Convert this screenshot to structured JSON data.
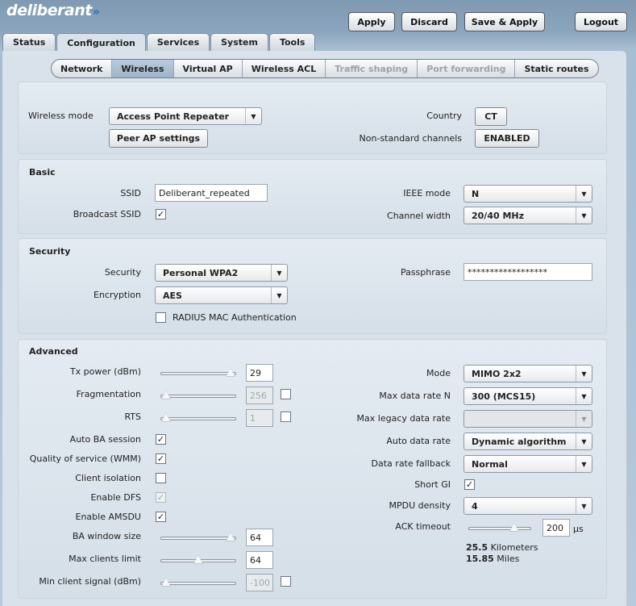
{
  "brand": {
    "name": "deliberant",
    "chevrons": "»"
  },
  "top_buttons": {
    "apply": "Apply",
    "discard": "Discard",
    "save_apply": "Save & Apply",
    "logout": "Logout"
  },
  "tabs": [
    "Status",
    "Configuration",
    "Services",
    "System",
    "Tools"
  ],
  "subtabs": [
    "Network",
    "Wireless",
    "Virtual AP",
    "Wireless ACL",
    "Traffic shaping",
    "Port forwarding",
    "Static routes"
  ],
  "general": {
    "wireless_mode_label": "Wireless mode",
    "wireless_mode_value": "Access Point Repeater",
    "peer_ap_button": "Peer AP settings",
    "country_label": "Country",
    "country_value": "CT",
    "nonstd_label": "Non-standard channels",
    "nonstd_value": "ENABLED"
  },
  "basic": {
    "title": "Basic",
    "ssid_label": "SSID",
    "ssid_value": "Deliberant_repeated",
    "broadcast_label": "Broadcast SSID",
    "broadcast_checked": true,
    "ieee_label": "IEEE mode",
    "ieee_value": "N",
    "channel_width_label": "Channel width",
    "channel_width_value": "20/40 MHz"
  },
  "security": {
    "title": "Security",
    "security_label": "Security",
    "security_value": "Personal WPA2",
    "encryption_label": "Encryption",
    "encryption_value": "AES",
    "radius_label": "RADIUS MAC Authentication",
    "radius_checked": false,
    "passphrase_label": "Passphrase",
    "passphrase_value": "******************"
  },
  "advanced": {
    "title": "Advanced",
    "tx_power_label": "Tx power (dBm)",
    "tx_power_value": "29",
    "tx_power_level": 1.0,
    "fragmentation_label": "Fragmentation",
    "fragmentation_value": "256",
    "rts_label": "RTS",
    "rts_value": "1",
    "auto_ba_label": "Auto BA session",
    "qos_label": "Quality of service (WMM)",
    "client_isolation_label": "Client isolation",
    "dfs_label": "Enable DFS",
    "amsdu_label": "Enable AMSDU",
    "ba_window_label": "BA window size",
    "ba_window_value": "64",
    "ba_window_level": 1.0,
    "max_clients_label": "Max clients limit",
    "max_clients_value": "64",
    "max_clients_level": 0.5,
    "min_signal_label": "Min client signal (dBm)",
    "min_signal_value": "-100",
    "mode_label": "Mode",
    "mode_value": "MIMO 2x2",
    "max_rate_n_label": "Max data rate N",
    "max_rate_n_value": "300 (MCS15)",
    "max_legacy_label": "Max legacy data rate",
    "max_legacy_value": "",
    "auto_rate_label": "Auto data rate",
    "auto_rate_value": "Dynamic algorithm",
    "fallback_label": "Data rate fallback",
    "fallback_value": "Normal",
    "short_gi_label": "Short GI",
    "mpdu_label": "MPDU density",
    "mpdu_value": "4",
    "ack_label": "ACK timeout",
    "ack_value": "200",
    "ack_unit": "µs",
    "km_value": "25.5",
    "km_unit": "Kilometers",
    "miles_value": "15.85",
    "miles_unit": "Miles"
  },
  "icons": {
    "check": "✓",
    "dropdown": "▼"
  }
}
